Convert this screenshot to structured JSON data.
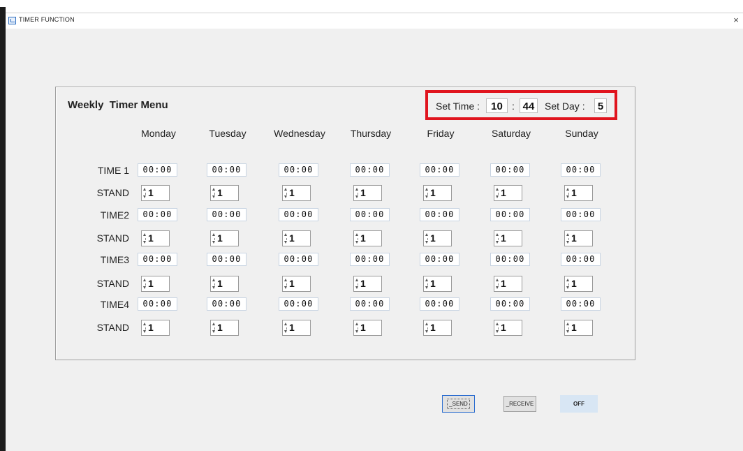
{
  "window": {
    "title": "TIMER FUNCTION",
    "close_glyph": "×",
    "icon": "calendar-icon"
  },
  "panel": {
    "title": "Weekly  Timer Menu"
  },
  "set_time": {
    "label": "Set Time :",
    "hour": "10",
    "separator": ":",
    "minute": "44",
    "day_label": "Set Day :",
    "day": "5"
  },
  "days": [
    "Monday",
    "Tuesday",
    "Wednesday",
    "Thursday",
    "Friday",
    "Saturday",
    "Sunday"
  ],
  "rows": [
    {
      "type": "time",
      "label": "TIME 1",
      "values": [
        "00:00",
        "00:00",
        "00:00",
        "00:00",
        "00:00",
        "00:00",
        "00:00"
      ]
    },
    {
      "type": "stand",
      "label": "STAND",
      "values": [
        "1",
        "1",
        "1",
        "1",
        "1",
        "1",
        "1"
      ]
    },
    {
      "type": "time",
      "label": "TIME2",
      "values": [
        "00:00",
        "00:00",
        "00:00",
        "00:00",
        "00:00",
        "00:00",
        "00:00"
      ]
    },
    {
      "type": "stand",
      "label": "STAND",
      "values": [
        "1",
        "1",
        "1",
        "1",
        "1",
        "1",
        "1"
      ]
    },
    {
      "type": "time",
      "label": "TIME3",
      "values": [
        "00:00",
        "00:00",
        "00:00",
        "00:00",
        "00:00",
        "00:00",
        "00:00"
      ]
    },
    {
      "type": "stand",
      "label": "STAND",
      "values": [
        "1",
        "1",
        "1",
        "1",
        "1",
        "1",
        "1"
      ]
    },
    {
      "type": "time",
      "label": "TIME4",
      "values": [
        "00:00",
        "00:00",
        "00:00",
        "00:00",
        "00:00",
        "00:00",
        "00:00"
      ]
    },
    {
      "type": "stand",
      "label": "STAND",
      "values": [
        "1",
        "1",
        "1",
        "1",
        "1",
        "1",
        "1"
      ]
    }
  ],
  "buttons": {
    "send": "_SEND",
    "receive": "_RECEIVE",
    "off": "OFF"
  },
  "colors": {
    "highlight": "#e0141e",
    "off_button": "#d8e6f4",
    "focus_border": "#2e6fd0"
  }
}
